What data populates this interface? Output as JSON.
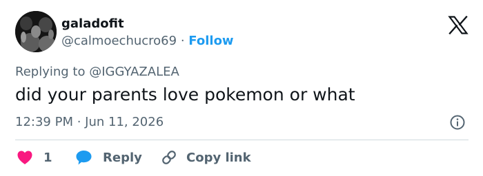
{
  "user": {
    "display_name": "galadofit",
    "handle": "@calmoechucro69",
    "separator": "·",
    "follow_label": "Follow"
  },
  "reply_context": "Replying to @IGGYAZALEA",
  "tweet": {
    "text": "did your parents love pokemon or what",
    "timestamp": "12:39 PM · Jun 11, 2026"
  },
  "actions": {
    "like_count": "1",
    "reply_label": "Reply",
    "copy_label": "Copy link"
  },
  "icons": {
    "brand": "x-logo-icon",
    "info": "info-icon",
    "like": "heart-icon",
    "reply": "speech-bubble-icon",
    "copy": "link-icon"
  },
  "colors": {
    "text_primary": "#0f1419",
    "text_secondary": "#536471",
    "follow": "#1d9bf0",
    "heart": "#f91880",
    "reply_bubble": "#1d9bf0",
    "divider": "#cfd9de"
  }
}
